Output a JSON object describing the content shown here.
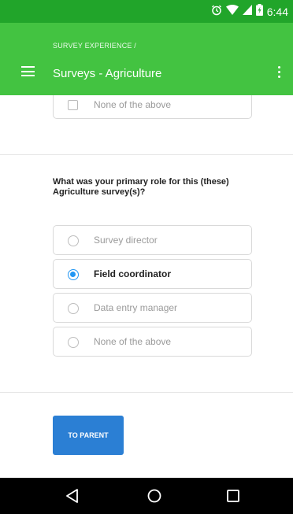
{
  "status_bar": {
    "time": "6:44",
    "icons": [
      "alarm-icon",
      "wifi-icon",
      "signal-icon",
      "battery-charging-icon"
    ]
  },
  "app_bar": {
    "breadcrumb": "SURVEY EXPERIENCE /",
    "title": "Surveys - Agriculture",
    "icons": [
      "menu-icon",
      "more-vert-icon"
    ]
  },
  "previous_question": {
    "options": [
      {
        "label": "None of the above",
        "type": "checkbox",
        "checked": false
      }
    ]
  },
  "role_question": {
    "text": "What was your primary role for this (these) Agriculture survey(s)?",
    "options": [
      {
        "label": "Survey director",
        "selected": false
      },
      {
        "label": "Field coordinator",
        "selected": true
      },
      {
        "label": "Data entry manager",
        "selected": false
      },
      {
        "label": "None of the above",
        "selected": false
      }
    ]
  },
  "actions": {
    "to_parent_label": "TO PARENT"
  },
  "nav_bar": {
    "icons": [
      "back-icon",
      "home-icon",
      "recents-icon"
    ]
  },
  "colors": {
    "status_bar": "#21a52a",
    "app_bar": "#43c341",
    "accent": "#2196f3",
    "button": "#2b7fd4",
    "nav_bar": "#000000"
  }
}
